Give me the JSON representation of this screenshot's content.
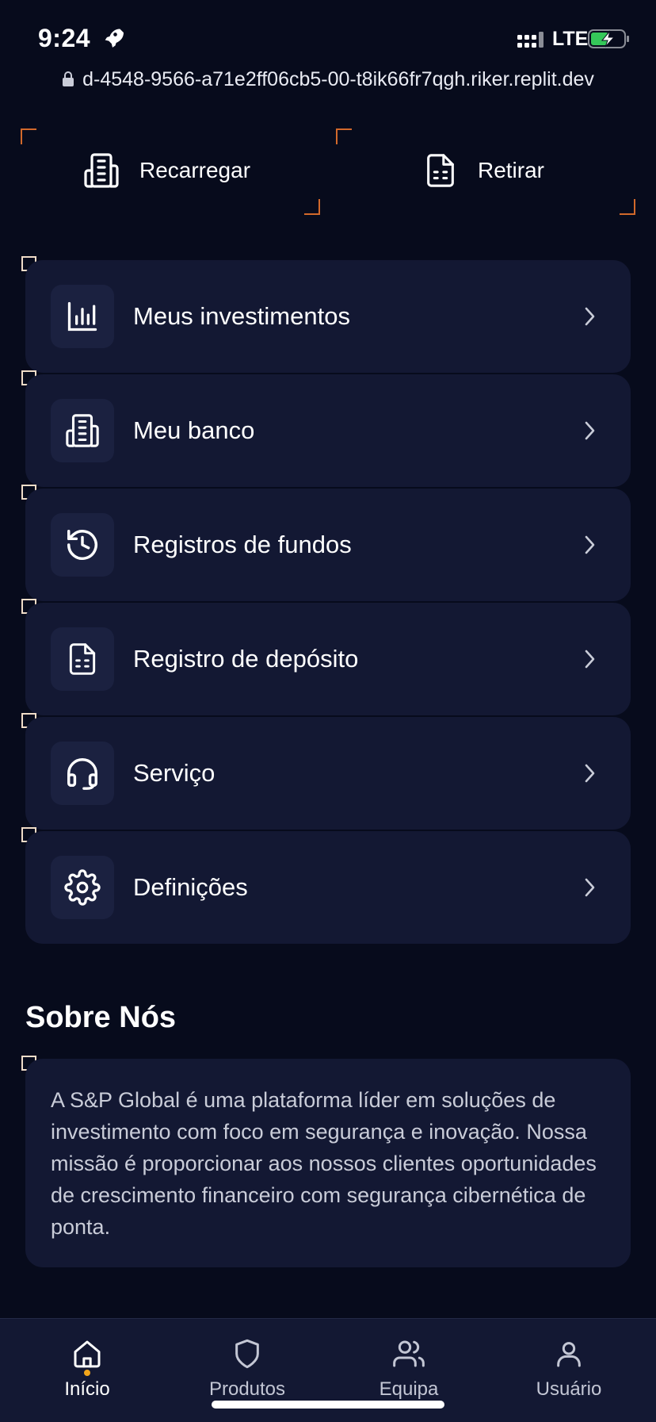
{
  "status_bar": {
    "time": "9:24",
    "network": "LTE",
    "icons": [
      "rocket-icon",
      "signal-icon",
      "battery-charging-icon"
    ]
  },
  "browser": {
    "url": "d-4548-9566-a71e2ff06cb5-00-t8ik66fr7qgh.riker.replit.dev"
  },
  "actions": {
    "recharge": {
      "label": "Recarregar",
      "icon": "building-icon"
    },
    "withdraw": {
      "label": "Retirar",
      "icon": "document-icon"
    }
  },
  "menu": {
    "items": [
      {
        "label": "Meus investimentos",
        "icon": "bar-chart-icon"
      },
      {
        "label": "Meu banco",
        "icon": "building-icon"
      },
      {
        "label": "Registros de fundos",
        "icon": "history-icon"
      },
      {
        "label": "Registro de depósito",
        "icon": "document-icon"
      },
      {
        "label": "Serviço",
        "icon": "headset-icon"
      },
      {
        "label": "Definições",
        "icon": "gear-icon"
      }
    ]
  },
  "about": {
    "title": "Sobre Nós",
    "text": "A S&P Global é uma plataforma líder em soluções de investimento com foco em segurança e inovação. Nossa missão é proporcionar aos nossos clientes oportunidades de crescimento financeiro com segurança cibernética de ponta."
  },
  "bottom_nav": {
    "items": [
      {
        "label": "Início",
        "icon": "home-icon",
        "active": true
      },
      {
        "label": "Produtos",
        "icon": "shield-icon",
        "active": false
      },
      {
        "label": "Equipa",
        "icon": "users-icon",
        "active": false
      },
      {
        "label": "Usuário",
        "icon": "user-icon",
        "active": false
      }
    ]
  },
  "colors": {
    "background": "#070b1c",
    "card": "#131833",
    "icon_box": "#1b2140",
    "accent_corner": "#d2692b",
    "active_dot": "#f2a51a"
  }
}
